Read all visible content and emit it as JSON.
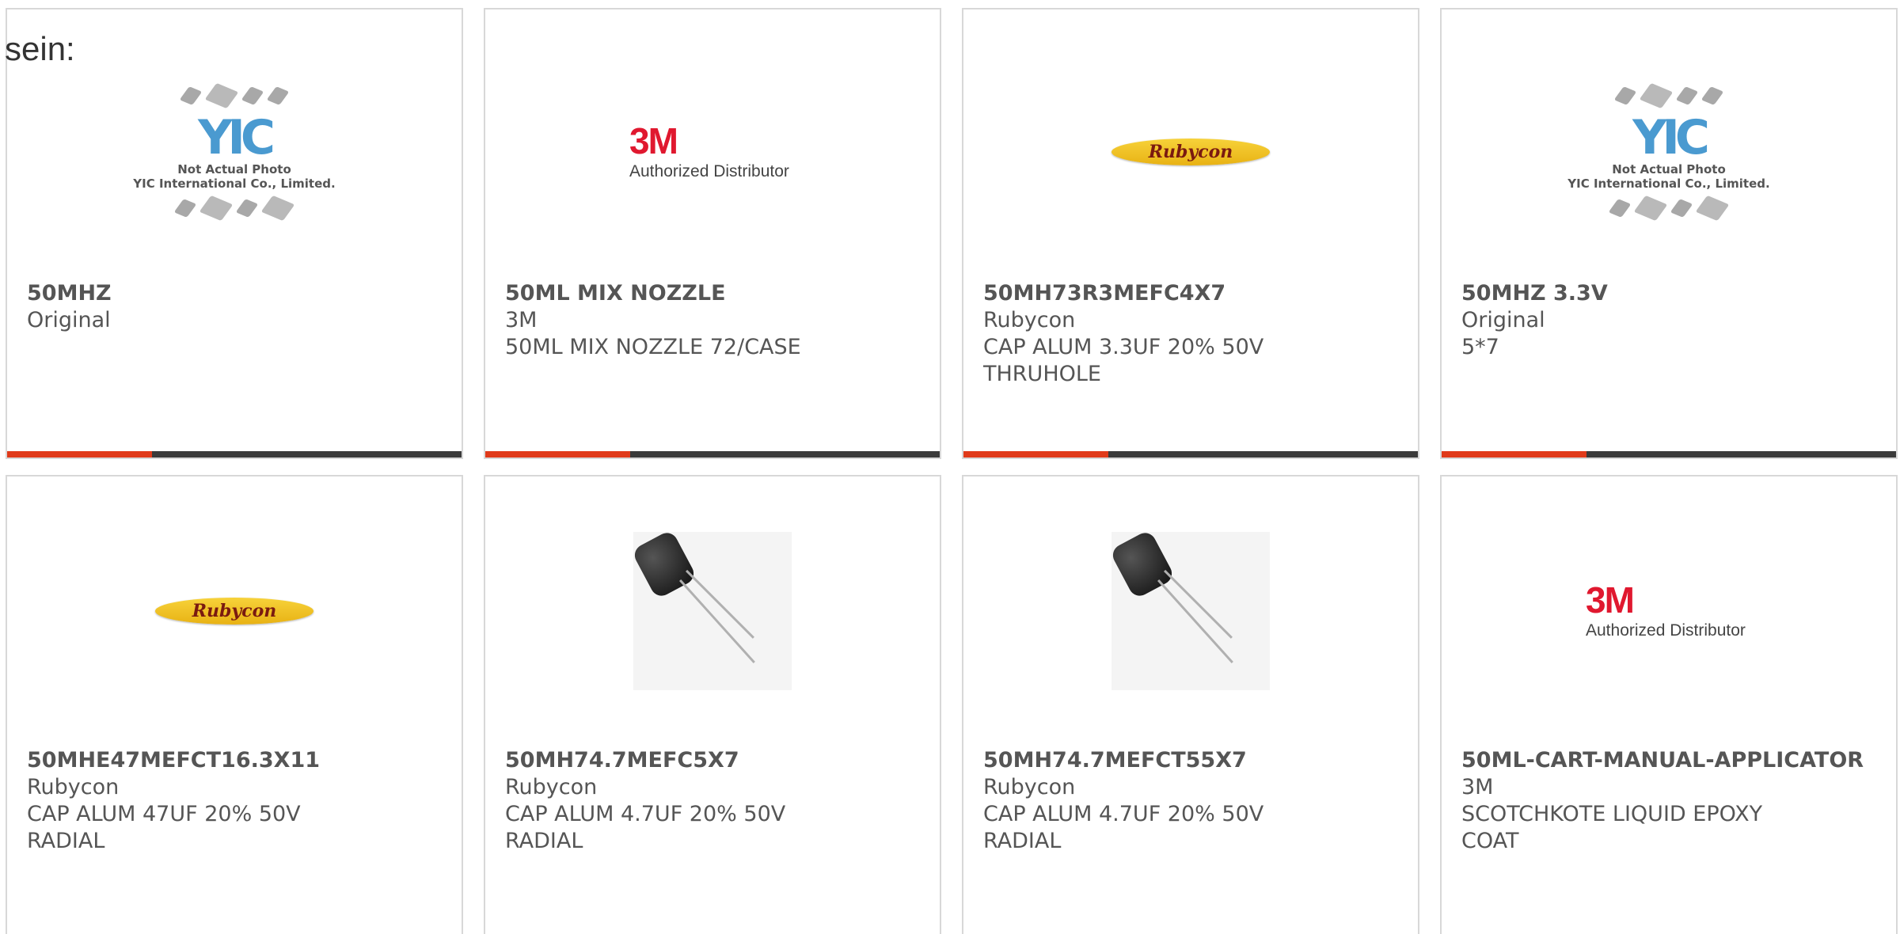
{
  "top_label": "sein:",
  "accent_color": "#e03a1a",
  "bar_color": "#3a3a3a",
  "cards": [
    {
      "part": "50MHZ",
      "lines": [
        "Original"
      ],
      "image": "yic-placeholder",
      "yic_caption_1": "Not Actual Photo",
      "yic_caption_2": "YIC International Co., Limited."
    },
    {
      "part": "50ML MIX NOZZLE",
      "lines": [
        "3M",
        "50ML MIX NOZZLE 72/CASE"
      ],
      "image": "3m-logo",
      "logo_big": "3M",
      "logo_small": "Authorized Distributor"
    },
    {
      "part": "50MH73R3MEFC4X7",
      "lines": [
        "Rubycon",
        "CAP ALUM 3.3UF 20% 50V",
        "THRUHOLE"
      ],
      "image": "rubycon-logo",
      "logo_text": "Rubycon"
    },
    {
      "part": "50MHZ 3.3V",
      "lines": [
        "Original",
        "5*7"
      ],
      "image": "yic-placeholder",
      "yic_caption_1": "Not Actual Photo",
      "yic_caption_2": "YIC International Co., Limited."
    },
    {
      "part": "50MHE47MEFCT16.3X11",
      "lines": [
        "Rubycon",
        "CAP ALUM 47UF 20% 50V",
        "RADIAL"
      ],
      "image": "rubycon-logo",
      "logo_text": "Rubycon"
    },
    {
      "part": "50MH74.7MEFC5X7",
      "lines": [
        "Rubycon",
        "CAP ALUM 4.7UF 20% 50V",
        "RADIAL"
      ],
      "image": "capacitor-photo"
    },
    {
      "part": "50MH74.7MEFCT55X7",
      "lines": [
        "Rubycon",
        "CAP ALUM 4.7UF 20% 50V",
        "RADIAL"
      ],
      "image": "capacitor-photo"
    },
    {
      "part": "50ML-CART-MANUAL-APPLICATOR",
      "lines": [
        "3M",
        "SCOTCHKOTE LIQUID EPOXY",
        "COAT"
      ],
      "image": "3m-logo",
      "logo_big": "3M",
      "logo_small": "Authorized Distributor"
    }
  ]
}
